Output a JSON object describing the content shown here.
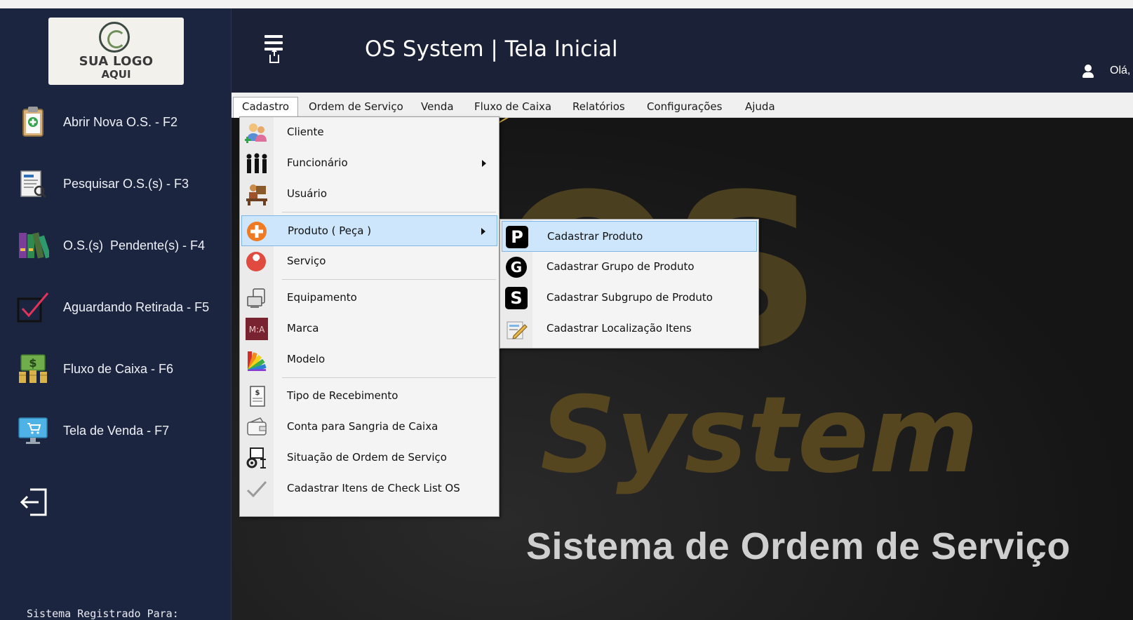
{
  "header": {
    "title": "OS System | Tela Inicial",
    "greeting": "Olá,"
  },
  "logo": {
    "line1": "SUA LOGO",
    "line2": "AQUI"
  },
  "sidebar": {
    "items": [
      {
        "label": "Abrir Nova O.S. - F2",
        "icon": "clipboard-plus-icon"
      },
      {
        "label": "Pesquisar O.S.(s) - F3",
        "icon": "document-search-icon"
      },
      {
        "label": "O.S.(s)  Pendente(s) - F4",
        "icon": "binders-icon"
      },
      {
        "label": "Aguardando Retirada - F5",
        "icon": "checkbox-check-icon"
      },
      {
        "label": "Fluxo de Caixa - F6",
        "icon": "money-stack-icon"
      },
      {
        "label": "Tela de Venda - F7",
        "icon": "monitor-cart-icon"
      }
    ],
    "exit_icon": "exit-icon",
    "registered_text": "Sistema Registrado Para:"
  },
  "menubar": {
    "items": [
      "Cadastro",
      "Ordem de Serviço",
      "Venda",
      "Fluxo de Caixa",
      "Relatórios",
      "Configurações",
      "Ajuda"
    ],
    "open_item": "Cadastro"
  },
  "cadastro_menu": {
    "items": [
      {
        "label": "Cliente",
        "icon": "client-icon"
      },
      {
        "label": "Funcionário",
        "icon": "employees-icon",
        "submenu": true
      },
      {
        "label": "Usuário",
        "icon": "user-desk-icon"
      },
      {
        "label": "Produto ( Peça )",
        "icon": "plus-circle-icon",
        "submenu": true,
        "highlighted": true
      },
      {
        "label": "Serviço",
        "icon": "wrench-icon"
      },
      {
        "label": "Equipamento",
        "icon": "equipment-icon"
      },
      {
        "label": "Marca",
        "icon": "brand-icon"
      },
      {
        "label": "Modelo",
        "icon": "color-palette-icon"
      },
      {
        "label": "Tipo de Recebimento",
        "icon": "receipt-icon"
      },
      {
        "label": "Conta para Sangria de Caixa",
        "icon": "wallet-icon"
      },
      {
        "label": "Situação de Ordem de Serviço",
        "icon": "gear-status-icon"
      },
      {
        "label": "Cadastrar Itens de Check List OS",
        "icon": "checkmark-icon"
      }
    ]
  },
  "produto_submenu": {
    "items": [
      {
        "label": "Cadastrar Produto",
        "icon_letter": "P",
        "icon": "p-icon",
        "highlighted": true
      },
      {
        "label": "Cadastrar Grupo de Produto",
        "icon_letter": "G",
        "icon": "g-icon"
      },
      {
        "label": "Cadastrar Subgrupo de Produto",
        "icon_letter": "S",
        "icon": "s-icon"
      },
      {
        "label": "Cadastrar Localização Itens",
        "icon": "location-pencil-icon"
      }
    ]
  },
  "background": {
    "watermark_big": "OS",
    "watermark_mid": "System",
    "subtitle": "Sistema de Ordem de Serviço"
  },
  "colors": {
    "sidebar_bg": "#1c2540",
    "header_bg": "#1b2136",
    "menu_highlight": "#cde6fb",
    "menu_highlight_border": "#7fb6e8"
  }
}
